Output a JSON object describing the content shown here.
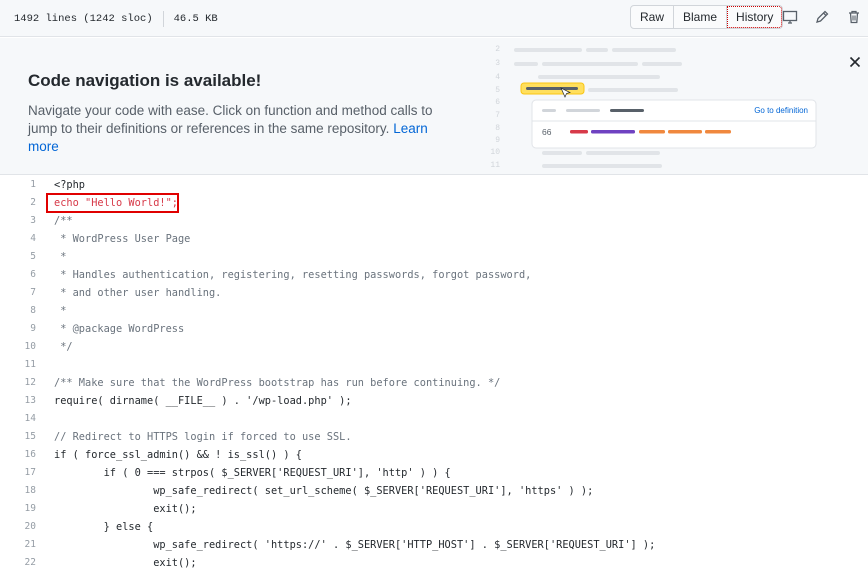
{
  "file_header": {
    "lines_info": "1492 lines (1242 sloc)",
    "size": "46.5 KB",
    "buttons": [
      "Raw",
      "Blame",
      "History"
    ],
    "icons": [
      "desktop-icon",
      "pencil-icon",
      "trash-icon"
    ]
  },
  "banner": {
    "title": "Code navigation is available!",
    "text": "Navigate your code with ease. Click on function and method calls to jump to their definitions or references in the same repository.",
    "link": "Learn more",
    "illustration": {
      "line_numbers": [
        "2",
        "3",
        "4",
        "5",
        "6",
        "7",
        "8",
        "9",
        "10",
        "11"
      ],
      "popup_link": "Go to definition",
      "popup_ref": "66"
    }
  },
  "colors": {
    "keyword": "#d73a49",
    "comment": "#6a737d",
    "string": "#032f62",
    "function": "#6f42c1",
    "link": "#0366d6",
    "highlight_box": "#e00000"
  },
  "code_lines": [
    {
      "n": "1",
      "text": "<?php"
    },
    {
      "n": "2",
      "text": "echo \"Hello World!\";"
    },
    {
      "n": "3",
      "text": "/**"
    },
    {
      "n": "4",
      "text": " * WordPress User Page"
    },
    {
      "n": "5",
      "text": " *"
    },
    {
      "n": "6",
      "text": " * Handles authentication, registering, resetting passwords, forgot password,"
    },
    {
      "n": "7",
      "text": " * and other user handling."
    },
    {
      "n": "8",
      "text": " *"
    },
    {
      "n": "9",
      "text": " * @package WordPress"
    },
    {
      "n": "10",
      "text": " */"
    },
    {
      "n": "11",
      "text": ""
    },
    {
      "n": "12",
      "text": "/** Make sure that the WordPress bootstrap has run before continuing. */"
    },
    {
      "n": "13",
      "text": "require( dirname( __FILE__ ) . '/wp-load.php' );"
    },
    {
      "n": "14",
      "text": ""
    },
    {
      "n": "15",
      "text": "// Redirect to HTTPS login if forced to use SSL."
    },
    {
      "n": "16",
      "text": "if ( force_ssl_admin() && ! is_ssl() ) {"
    },
    {
      "n": "17",
      "text": "        if ( 0 === strpos( $_SERVER['REQUEST_URI'], 'http' ) ) {"
    },
    {
      "n": "18",
      "text": "                wp_safe_redirect( set_url_scheme( $_SERVER['REQUEST_URI'], 'https' ) );"
    },
    {
      "n": "19",
      "text": "                exit();"
    },
    {
      "n": "20",
      "text": "        } else {"
    },
    {
      "n": "21",
      "text": "                wp_safe_redirect( 'https://' . $_SERVER['HTTP_HOST'] . $_SERVER['REQUEST_URI'] );"
    },
    {
      "n": "22",
      "text": "                exit();"
    }
  ]
}
